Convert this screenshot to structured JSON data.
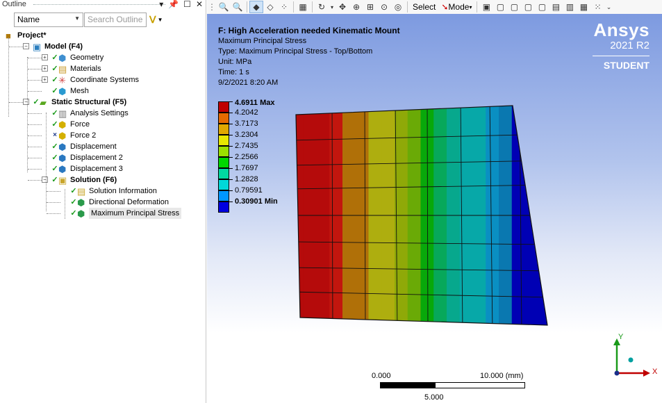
{
  "outline": {
    "title": "Outline",
    "controls": [
      "▾",
      "ꟷ",
      "☐",
      "✕"
    ],
    "filter": {
      "selected": "Name",
      "search_placeholder": "Search Outline"
    },
    "tree": [
      {
        "label": "Project*",
        "bold": true,
        "icon": "project-icon"
      },
      {
        "label": "Model (F4)",
        "bold": true,
        "icon": "model-icon"
      },
      {
        "label": "Geometry",
        "bold": false,
        "icon": "geometry-icon"
      },
      {
        "label": "Materials",
        "bold": false,
        "icon": "materials-icon"
      },
      {
        "label": "Coordinate Systems",
        "bold": false,
        "icon": "coordinate-systems-icon"
      },
      {
        "label": "Mesh",
        "bold": false,
        "icon": "mesh-icon"
      },
      {
        "label": "Static Structural (F5)",
        "bold": true,
        "icon": "static-structural-icon"
      },
      {
        "label": "Analysis Settings",
        "bold": false,
        "icon": "analysis-settings-icon"
      },
      {
        "label": "Force",
        "bold": false,
        "icon": "force-icon"
      },
      {
        "label": "Force 2",
        "bold": false,
        "icon": "force-icon"
      },
      {
        "label": "Displacement",
        "bold": false,
        "icon": "displacement-icon"
      },
      {
        "label": "Displacement 2",
        "bold": false,
        "icon": "displacement-icon"
      },
      {
        "label": "Displacement 3",
        "bold": false,
        "icon": "displacement-icon"
      },
      {
        "label": "Solution (F6)",
        "bold": true,
        "icon": "solution-icon"
      },
      {
        "label": "Solution Information",
        "bold": false,
        "icon": "solution-information-icon"
      },
      {
        "label": "Directional Deformation",
        "bold": false,
        "icon": "result-icon"
      },
      {
        "label": "Maximum Principal Stress",
        "bold": false,
        "icon": "result-icon"
      }
    ]
  },
  "toolbar": {
    "select_label": "Select",
    "mode_label": "Mode"
  },
  "viewport": {
    "info": [
      "F: High Acceleration needed Kinematic Mount",
      "Maximum Principal Stress",
      "Type: Maximum Principal Stress - Top/Bottom",
      "Unit: MPa",
      "Time: 1 s",
      "9/2/2021 8:20 AM"
    ],
    "brand": {
      "name": "Ansys",
      "version": "2021 R2",
      "edition": "STUDENT"
    },
    "legend": [
      {
        "value": "4.6911 Max",
        "color": "#c00000",
        "bold": true
      },
      {
        "value": "4.2042",
        "color": "#e56a00",
        "bold": false
      },
      {
        "value": "3.7173",
        "color": "#e0a800",
        "bold": false
      },
      {
        "value": "3.2304",
        "color": "#e7e700",
        "bold": false
      },
      {
        "value": "2.7435",
        "color": "#9be000",
        "bold": false
      },
      {
        "value": "2.2566",
        "color": "#00d800",
        "bold": false
      },
      {
        "value": "1.7697",
        "color": "#00d8a0",
        "bold": false
      },
      {
        "value": "1.2828",
        "color": "#00d8d8",
        "bold": false
      },
      {
        "value": "0.79591",
        "color": "#0096ff",
        "bold": false
      },
      {
        "value": "0.30901 Min",
        "color": "#0000e0",
        "bold": true
      }
    ],
    "contour_bands": [
      "#b50b0b",
      "#b50b0b",
      "#b50b0b",
      "#c2160e",
      "#b07008",
      "#b07008",
      "#aeae0f",
      "#aeae0f",
      "#8fa908",
      "#6aaa06",
      "#08a80a",
      "#07a85a",
      "#07a88d",
      "#07a8a8",
      "#07a8a8",
      "#0a8fc2",
      "#0a78b0",
      "#0000b4",
      "#0000b4",
      "#0000b4"
    ],
    "scale": {
      "left": "0.000",
      "right": "10.000 (mm)",
      "mid": "5.000"
    },
    "triad": {
      "x": "X",
      "y": "Y"
    }
  }
}
